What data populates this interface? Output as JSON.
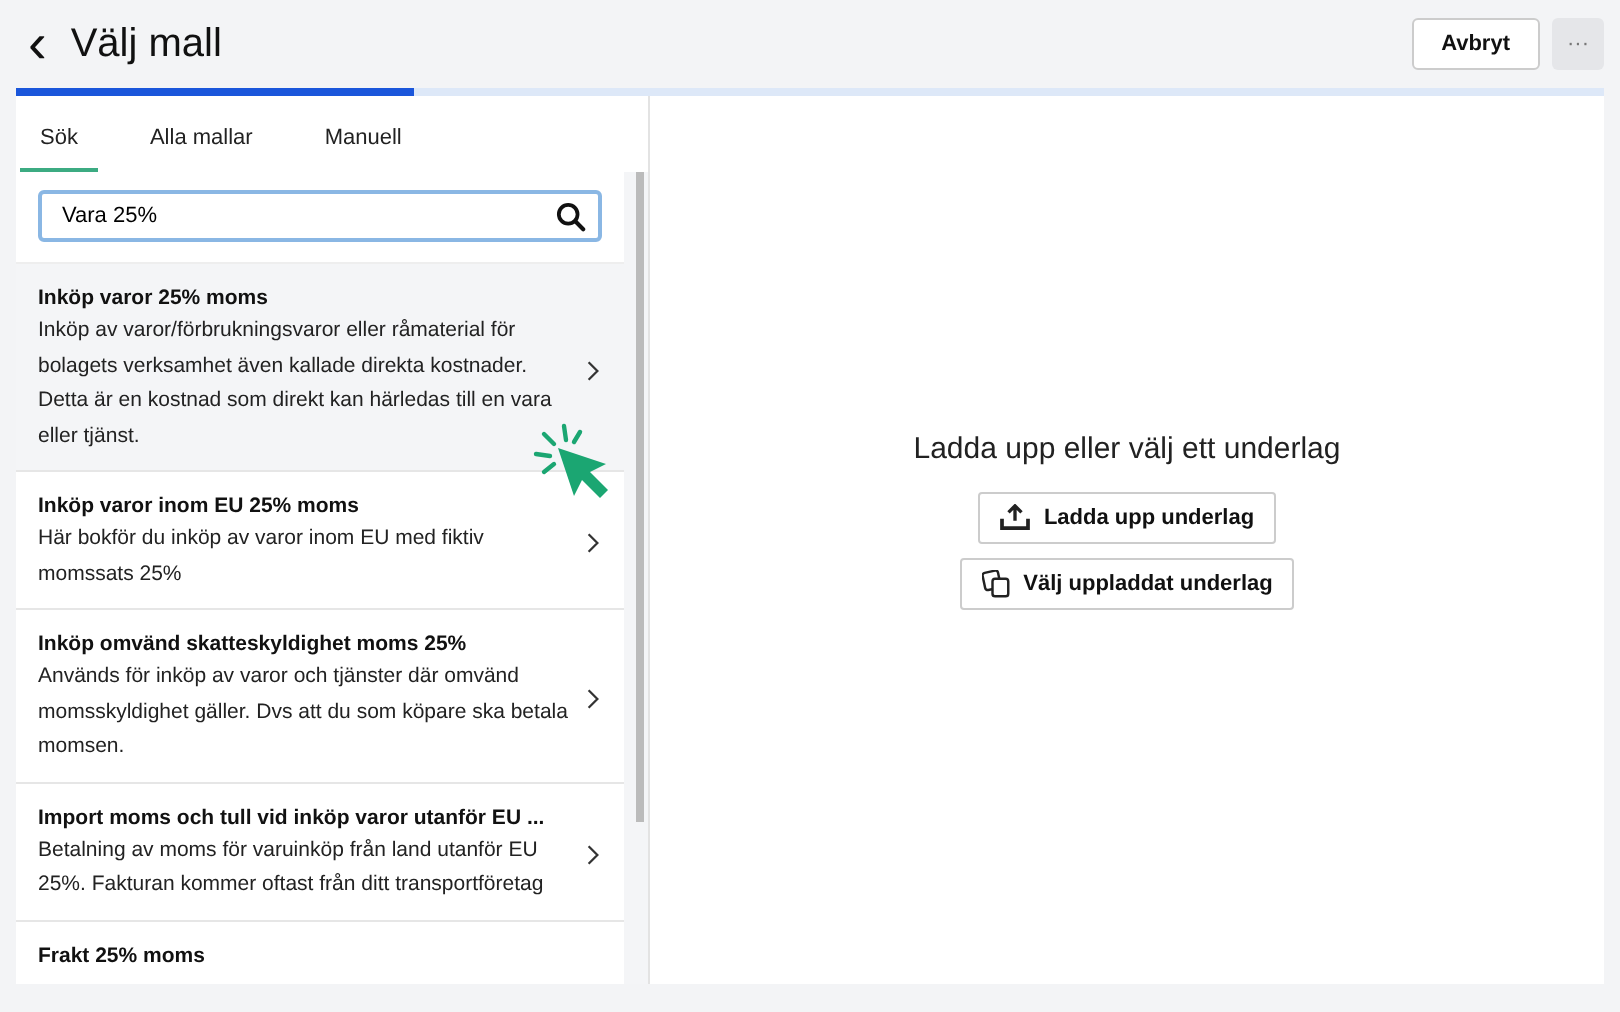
{
  "header": {
    "back_icon": "‹",
    "title": "Välj mall",
    "progress": {
      "level": 0.25
    },
    "buttons": [
      {
        "label": "Avbryt"
      },
      {
        "label": "···"
      }
    ]
  },
  "tabs": [
    {
      "label": "Sök",
      "selected": true
    },
    {
      "label": "Alla mallar",
      "selected": false
    },
    {
      "label": "Manuell",
      "selected": false
    }
  ],
  "search": {
    "value": "Vara 25%"
  },
  "templates": [
    {
      "title": "Inköp varor 25% moms",
      "description": "Inköp av varor/förbrukningsvaror eller råmaterial för bolagets verksamhet även kallade direkta kostnader. Detta är en kostnad som direkt kan härledas till en vara eller tjänst.",
      "selected": true
    },
    {
      "title": "Inköp varor inom EU 25% moms",
      "description": "Här bokför du inköp av varor inom EU med fiktiv momssats 25%",
      "selected": false
    },
    {
      "title": "Inköp omvänd skatteskyldighet moms 25%",
      "description": "Används för inköp av varor och tjänster där omvänd momsskyldighet gäller. Dvs att du som köpare ska betala momsen.",
      "selected": false
    },
    {
      "title": "Import moms och tull vid inköp varor utanför EU ...",
      "description": "Betalning av moms för varuinköp från land utanför EU 25%. Fakturan kommer oftast från ditt transportföretag",
      "selected": false
    },
    {
      "title": "Frakt 25% moms",
      "selected": false
    }
  ],
  "upload": {
    "heading": "Ladda upp eller välj ett underlag",
    "buttons": [
      {
        "kind": "upload",
        "label": "Ladda upp underlag"
      },
      {
        "kind": "choose",
        "label": "Välj uppladdat underlag"
      }
    ]
  }
}
